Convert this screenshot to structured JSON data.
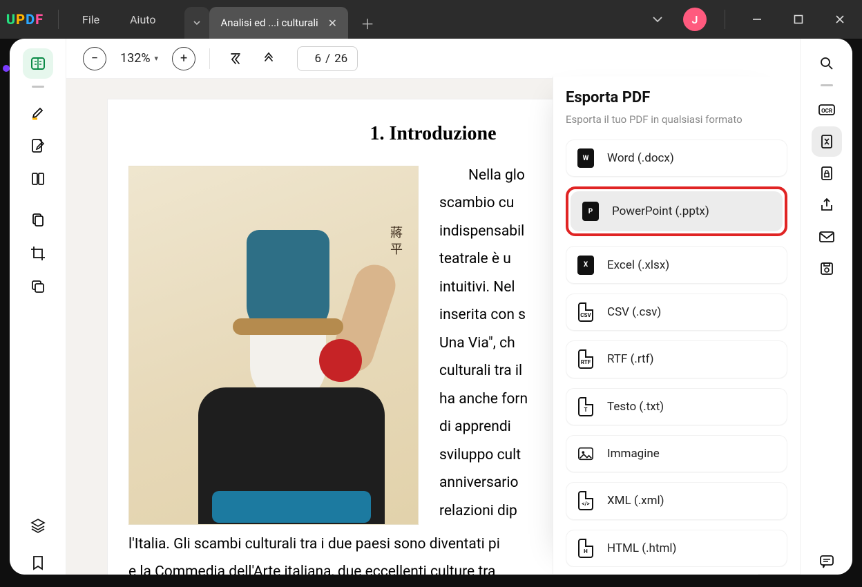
{
  "app": {
    "name_letters": [
      "U",
      "P",
      "D",
      "F"
    ],
    "menu": {
      "file": "File",
      "help": "Aiuto"
    },
    "tab_title": "Analisi ed ...i culturali",
    "account_initial": "J"
  },
  "toolbar": {
    "zoom": "132%",
    "page_current": "6",
    "page_sep": "/",
    "page_total": "26"
  },
  "document": {
    "heading": "1. Introduzione",
    "para_start": "Nella glo",
    "lines": [
      "scambio   cu",
      "indispensabil",
      "teatrale è u",
      "intuitivi. Nel",
      "inserita con s",
      "Una Via\", ch",
      "culturali tra il",
      "ha anche forn",
      "di   apprendi",
      "sviluppo cult",
      "anniversario",
      "relazioni  dip"
    ],
    "tail1": "l'Italia. Gli scambi culturali tra i due paesi sono diventati pi",
    "tail2": "e la Commedia dell'Arte italiana, due eccellenti culture tra",
    "fig_caption": "蔣平"
  },
  "export": {
    "title": "Esporta PDF",
    "subtitle": "Esporta il tuo PDF in qualsiasi formato",
    "items": [
      {
        "key": "word",
        "label": "Word (.docx)",
        "badge": "W"
      },
      {
        "key": "pptx",
        "label": "PowerPoint (.pptx)",
        "badge": "P",
        "highlight": true
      },
      {
        "key": "xlsx",
        "label": "Excel (.xlsx)",
        "badge": "X"
      },
      {
        "key": "csv",
        "label": "CSV (.csv)",
        "outline": "CSV"
      },
      {
        "key": "rtf",
        "label": "RTF (.rtf)",
        "outline": "RTF"
      },
      {
        "key": "txt",
        "label": "Testo (.txt)",
        "outline": "T"
      },
      {
        "key": "img",
        "label": "Immagine",
        "picto": "image"
      },
      {
        "key": "xml",
        "label": "XML (.xml)",
        "outline": "</>"
      },
      {
        "key": "html",
        "label": "HTML (.html)",
        "outline": "H"
      }
    ]
  },
  "left_tools": [
    {
      "name": "reader-mode",
      "active": true
    },
    {
      "name": "highlighter"
    },
    {
      "name": "annotate"
    },
    {
      "name": "page-layout"
    },
    {
      "name": "organize-pages"
    },
    {
      "name": "crop"
    },
    {
      "name": "batch"
    }
  ],
  "right_tools": [
    {
      "name": "search"
    },
    {
      "name": "ocr"
    },
    {
      "name": "convert",
      "active": true
    },
    {
      "name": "protect"
    },
    {
      "name": "share"
    },
    {
      "name": "email"
    },
    {
      "name": "save"
    }
  ]
}
